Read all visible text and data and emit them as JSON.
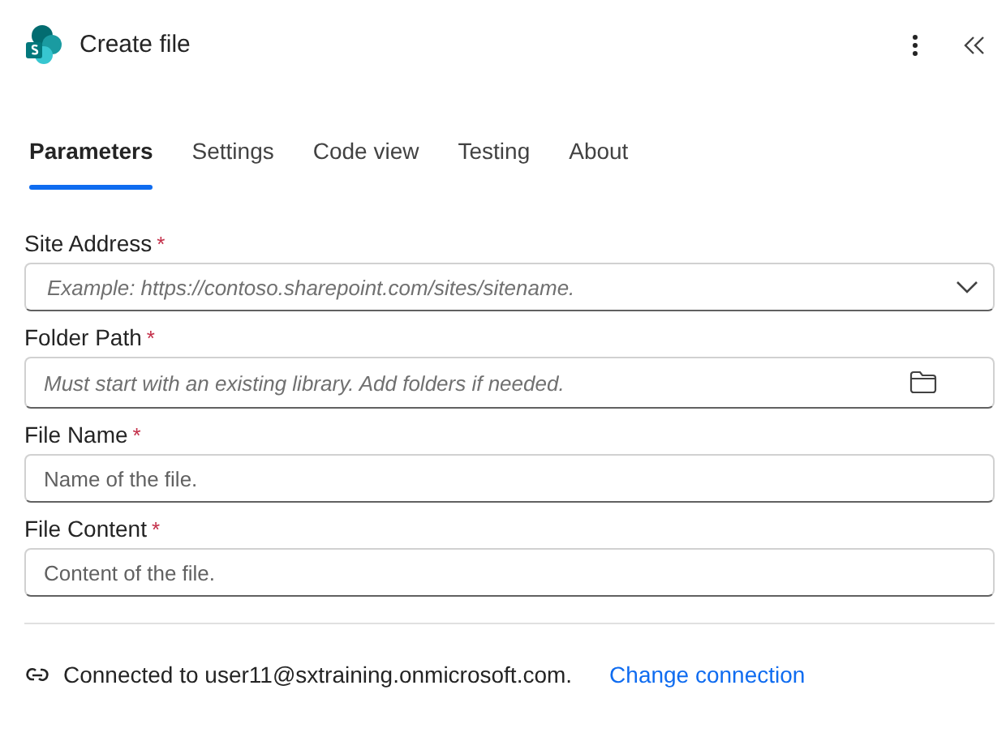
{
  "header": {
    "title": "Create file"
  },
  "tabs": [
    {
      "label": "Parameters",
      "selected": true
    },
    {
      "label": "Settings",
      "selected": false
    },
    {
      "label": "Code view",
      "selected": false
    },
    {
      "label": "Testing",
      "selected": false
    },
    {
      "label": "About",
      "selected": false
    }
  ],
  "fields": [
    {
      "kind": "dropdown",
      "label": "Site Address",
      "required_mark": "*",
      "placeholder": "Example: https://contoso.sharepoint.com/sites/sitename."
    },
    {
      "kind": "folder",
      "label": "Folder Path",
      "required_mark": "*",
      "placeholder": "Must start with an existing library. Add folders if needed."
    },
    {
      "kind": "text",
      "label": "File Name",
      "required_mark": "*",
      "placeholder": "Name of the file."
    },
    {
      "kind": "text",
      "label": "File Content",
      "required_mark": "*",
      "placeholder": "Content of the file."
    }
  ],
  "connection": {
    "text": "Connected to user11@sxtraining.onmicrosoft.com.",
    "link": "Change connection"
  }
}
